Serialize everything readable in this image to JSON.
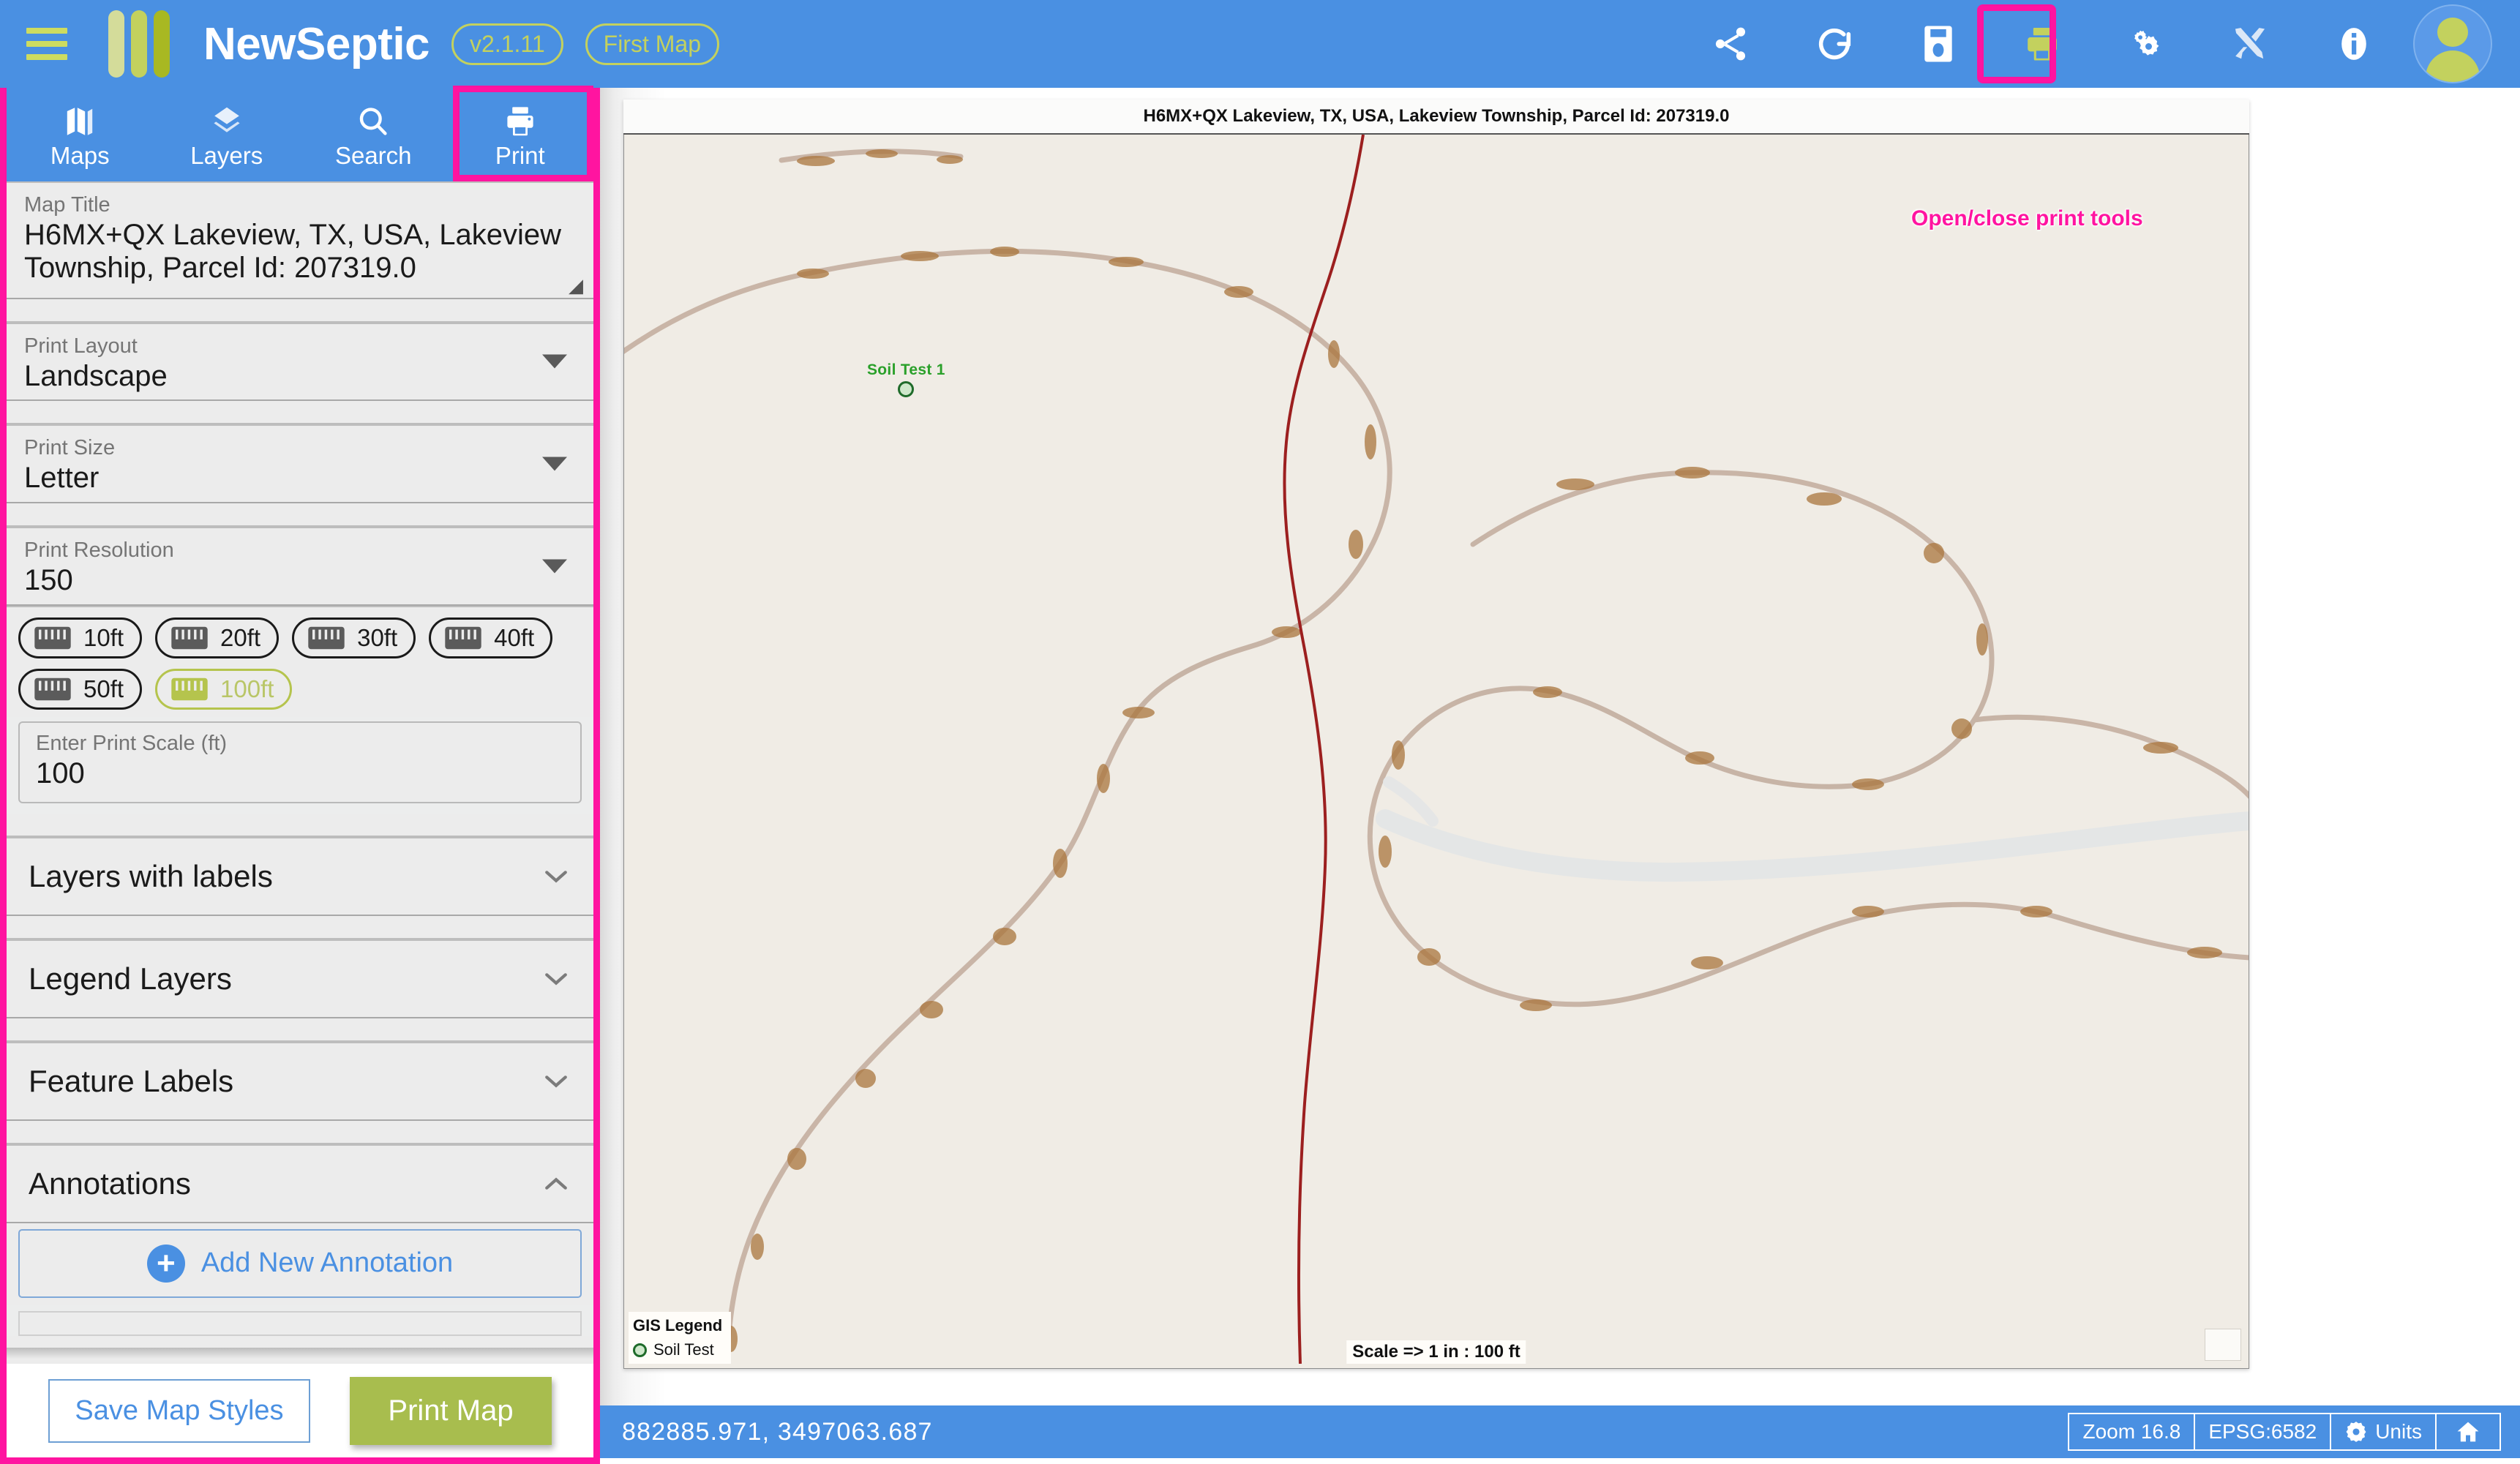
{
  "header": {
    "menu_icon": "hamburger-icon",
    "app_title": "NewSeptic",
    "version_badge": "v2.1.11",
    "map_badge": "First Map",
    "icons": [
      {
        "name": "share-icon",
        "label": "Share"
      },
      {
        "name": "refresh-icon",
        "label": "Refresh"
      },
      {
        "name": "save-icon",
        "label": "Save"
      },
      {
        "name": "print-icon",
        "label": "Print"
      },
      {
        "name": "settings-icon",
        "label": "Settings"
      },
      {
        "name": "tools-icon",
        "label": "Tools"
      },
      {
        "name": "info-icon",
        "label": "Info"
      }
    ],
    "avatar": "user-avatar"
  },
  "sidebar": {
    "tabs": [
      {
        "label": "Maps",
        "icon": "map-icon",
        "active": false
      },
      {
        "label": "Layers",
        "icon": "layers-icon",
        "active": false
      },
      {
        "label": "Search",
        "icon": "search-icon",
        "active": false
      },
      {
        "label": "Print",
        "icon": "printer-icon",
        "active": true
      }
    ],
    "map_title": {
      "label": "Map Title",
      "value": "H6MX+QX Lakeview, TX, USA, Lakeview Township,  Parcel Id: 207319.0"
    },
    "print_layout": {
      "label": "Print Layout",
      "value": "Landscape"
    },
    "print_size": {
      "label": "Print Size",
      "value": "Letter"
    },
    "print_resolution": {
      "label": "Print Resolution",
      "value": "150"
    },
    "scale_chips": [
      {
        "label": "10ft",
        "active": false
      },
      {
        "label": "20ft",
        "active": false
      },
      {
        "label": "30ft",
        "active": false
      },
      {
        "label": "40ft",
        "active": false
      },
      {
        "label": "50ft",
        "active": false
      },
      {
        "label": "100ft",
        "active": true
      }
    ],
    "print_scale": {
      "label": "Enter Print Scale (ft)",
      "value": "100"
    },
    "accordions": [
      {
        "label": "Layers with labels",
        "expanded": false
      },
      {
        "label": "Legend Layers",
        "expanded": false
      },
      {
        "label": "Feature Labels",
        "expanded": false
      },
      {
        "label": "Annotations",
        "expanded": true
      }
    ],
    "add_annotation_label": "Add New Annotation",
    "save_styles_label": "Save Map Styles",
    "print_map_label": "Print Map"
  },
  "map": {
    "preview_title": "H6MX+QX Lakeview, TX, USA, Lakeview Township,  Parcel Id: 207319.0",
    "soil_marker_label": "Soil Test 1",
    "legend_title": "GIS Legend",
    "legend_items": [
      {
        "label": "Soil Test",
        "color": "#cfe8cb"
      }
    ],
    "scale_note": "Scale => 1 in : 100 ft"
  },
  "callout": {
    "text": "Open/close print tools",
    "color": "#ff14a0"
  },
  "statusbar": {
    "coordinates": "882885.971, 3497063.687",
    "zoom": "Zoom 16.8",
    "epsg": "EPSG:6582",
    "units": "Units",
    "home_icon": "home-icon"
  },
  "colors": {
    "brand_blue": "#4a90e2",
    "accent_green": "#a8bd4e",
    "highlight_pink": "#ff14a0",
    "panel_gray": "#ececec"
  }
}
